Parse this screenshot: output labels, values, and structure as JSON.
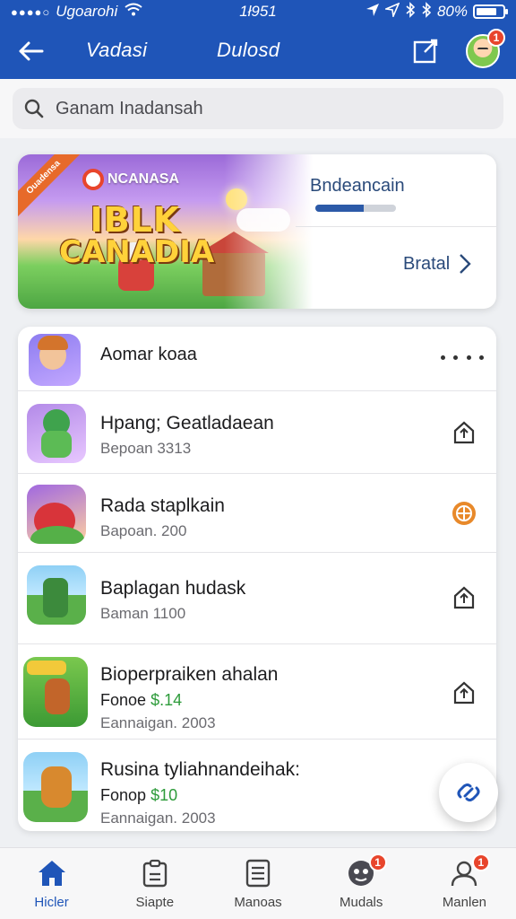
{
  "status_bar": {
    "carrier": "Ugoarohi",
    "time": "1ł951",
    "battery": "80%",
    "battery_level": 0.8
  },
  "header": {
    "title_left": "Vadasi",
    "title_right": "Dulosd",
    "profile_badge": "1"
  },
  "search": {
    "placeholder": "Ganam Inadansah"
  },
  "banner": {
    "ribbon": "Ouadensa",
    "brand": "NCANASA",
    "game_logo_line1": "IBLK",
    "game_logo_line2": "CANADIA",
    "title": "Bndeancain",
    "progress": 0.6,
    "link_label": "Bratal"
  },
  "apps": [
    {
      "title": "Aomar koaa"
    },
    {
      "title": "Hpang; Geatladaean",
      "subtitle": "Bepoan 3313"
    },
    {
      "title": "Rada staplkain",
      "subtitle": "Bapoan. 200"
    },
    {
      "title": "Baplagan hudask",
      "subtitle": "Baman 1100"
    },
    {
      "title": "Bioperpraiken ahalan",
      "price_label": "Fonoe",
      "price": "$.14",
      "subtitle": "Eannaigan. 2003"
    },
    {
      "title": "Rusina tyliahnandeihak:",
      "price_label": "Fonop",
      "price": "$10",
      "subtitle": "Eannaigan. 2003"
    }
  ],
  "tabs": [
    {
      "label": "Hicler",
      "badge": ""
    },
    {
      "label": "Siapte",
      "badge": ""
    },
    {
      "label": "Manoas",
      "badge": ""
    },
    {
      "label": "Mudals",
      "badge": "1"
    },
    {
      "label": "Manlen",
      "badge": "1"
    }
  ],
  "colors": {
    "brand_blue": "#1f55b8",
    "badge_red": "#e8452c",
    "price_green": "#2d9b3a",
    "accent_orange": "#e8892a"
  }
}
